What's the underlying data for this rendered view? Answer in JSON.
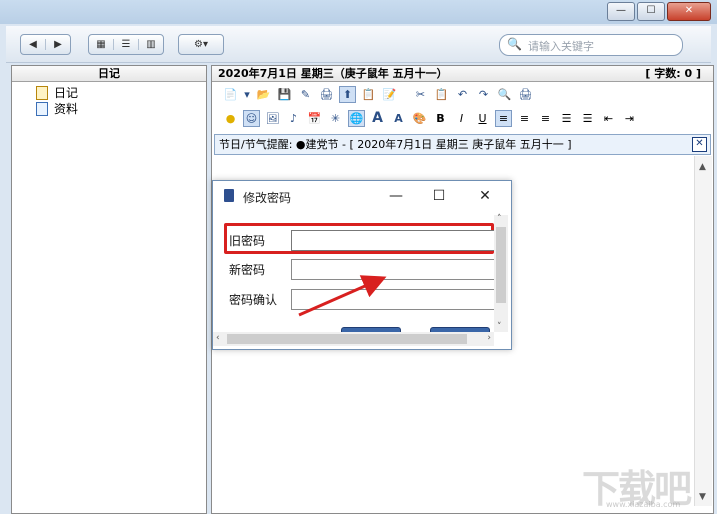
{
  "window": {
    "controls": {
      "minimize": "—",
      "maximize": "☐",
      "close": "✕"
    }
  },
  "toolbar": {
    "nav": {
      "back": "◀",
      "forward": "▶"
    },
    "views": {
      "grid": "▦",
      "list": "☰",
      "columns": "▥"
    },
    "settings": "⚙▾",
    "search": {
      "placeholder": "请输入关键字",
      "icon": "🔍"
    }
  },
  "sidebar": {
    "title": "日记",
    "items": [
      {
        "label": "日记",
        "icon": "diary-icon"
      },
      {
        "label": "资料",
        "icon": "document-icon"
      }
    ]
  },
  "editor": {
    "date_line": "2020年7月1日  星期三（庚子鼠年 五月十一）",
    "word_count": "[ 字数: 0 ]",
    "format_row1": [
      "📄",
      "▾",
      "📂",
      "💾",
      "✎",
      "🖨",
      "⬆",
      "📋",
      "📝",
      "",
      "✂",
      "📋",
      "↶",
      "↷",
      "🔍",
      "🖨"
    ],
    "format_row2": [
      "●",
      "☺",
      "🖼",
      "♪",
      "📅",
      "✳",
      "🌐",
      "A",
      "A",
      "🎨",
      "B",
      "I",
      "U",
      "≡",
      "≡",
      "≡",
      "☰",
      "☰",
      "⇤",
      "⇥"
    ],
    "holiday_text": "节日/节气提醒: ●建党节 - [ 2020年7月1日  星期三  庚子鼠年  五月十一 ]",
    "holiday_close": "✕"
  },
  "dialog": {
    "title": "修改密码",
    "controls": {
      "minimize": "—",
      "maximize": "☐",
      "close": "✕"
    },
    "fields": [
      {
        "label": "旧密码",
        "value": ""
      },
      {
        "label": "新密码",
        "value": ""
      },
      {
        "label": "密码确认",
        "value": ""
      }
    ]
  },
  "watermark": {
    "text": "下载吧",
    "url": "www.xiazaiba.com"
  },
  "colors": {
    "highlight": "#d8201f",
    "accent": "#2e4f8f"
  }
}
